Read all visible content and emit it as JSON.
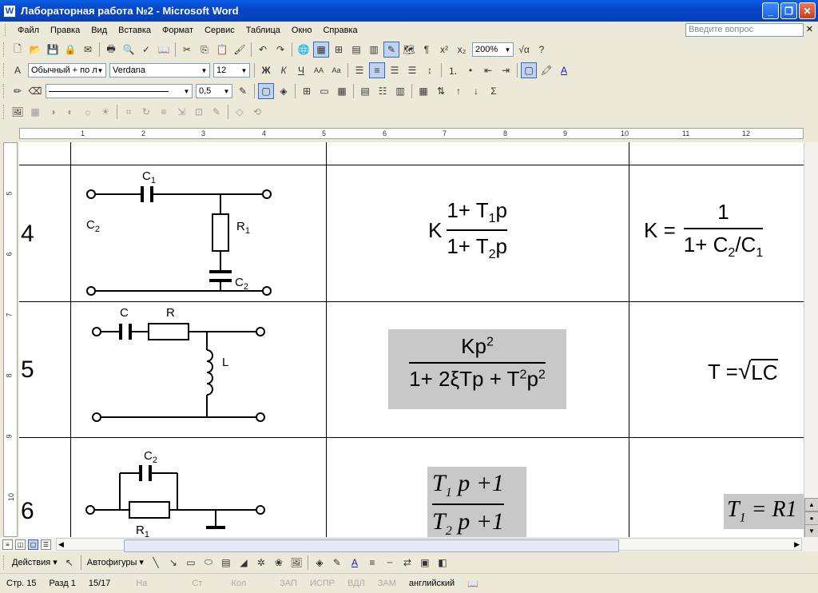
{
  "window": {
    "title": "Лабораторная работа №2 - Microsoft Word",
    "icon": "W"
  },
  "menu": [
    "Файл",
    "Правка",
    "Вид",
    "Вставка",
    "Формат",
    "Сервис",
    "Таблица",
    "Окно",
    "Справка"
  ],
  "ask_placeholder": "Введите вопрос",
  "toolbar": {
    "zoom": "200%",
    "style": "Обычный + по л",
    "font": "Verdana",
    "size": "12",
    "line_weight": "0,5"
  },
  "ruler_numbers": [
    "1",
    "2",
    "3",
    "4",
    "5",
    "6",
    "7",
    "8",
    "9",
    "10",
    "11",
    "12"
  ],
  "vruler_numbers": [
    "5",
    "6",
    "7",
    "8",
    "9",
    "10"
  ],
  "rows": [
    {
      "num": "4",
      "c1": "C",
      "c1sub": "1",
      "c2": "C",
      "c2sub": "2",
      "r1": "R",
      "r1sub": "1",
      "c2b": "C",
      "c2bsub": "2",
      "tf_k": "K",
      "tf_num": "1+ T",
      "tf_num_sub": "1",
      "tf_num_end": "p",
      "tf_den": "1+ T",
      "tf_den_sub": "2",
      "tf_den_end": "p",
      "p_lhs": "K =",
      "p_num": "1",
      "p_den": "1+ C",
      "p_den_sub": "2",
      "p_den_mid": "/C",
      "p_den_sub2": "1"
    },
    {
      "num": "5",
      "c": "C",
      "r": "R",
      "l": "L",
      "tf_num": "Kp",
      "tf_num_sup": "2",
      "tf_den": "1+ 2ξTp + T",
      "tf_den_sup": "2",
      "tf_den_mid": "p",
      "tf_den_sup2": "2",
      "p_lhs": "T = ",
      "p_rad": "LC"
    },
    {
      "num": "6",
      "c2": "C",
      "c2sub": "2",
      "r1": "R",
      "r1sub": "1",
      "tf_num": "T",
      "tf_num_sub": "1",
      "tf_num_end": "p +1",
      "tf_den": "T",
      "tf_den_sub": "2",
      "tf_den_end": "p +1",
      "p_lhs": "T",
      "p_lhs_sub": "1",
      "p_rhs": "= R1"
    }
  ],
  "drawbar": {
    "actions": "Действия",
    "autoshapes": "Автофигуры"
  },
  "status": {
    "page": "Стр. 15",
    "section": "Разд 1",
    "pages": "15/17",
    "at": "На",
    "line": "Ст",
    "col": "Кол",
    "rec": "ЗАП",
    "trk": "ИСПР",
    "ext": "ВДЛ",
    "ovr": "ЗАМ",
    "lang": "английский"
  }
}
